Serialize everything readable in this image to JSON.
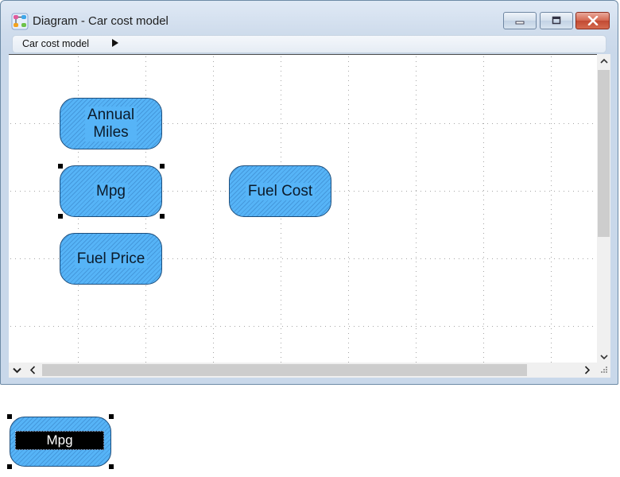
{
  "window": {
    "title": "Diagram - Car cost model",
    "controls": [
      "minimize",
      "maximize",
      "close"
    ]
  },
  "breadcrumb": {
    "items": [
      "Car cost model"
    ]
  },
  "nodes": [
    {
      "id": "annual-miles",
      "label": "Annual\nMiles",
      "selected": false
    },
    {
      "id": "mpg",
      "label": "Mpg",
      "selected": true
    },
    {
      "id": "fuel-price",
      "label": "Fuel Price",
      "selected": false
    },
    {
      "id": "fuel-cost",
      "label": "Fuel Cost",
      "selected": false
    }
  ],
  "preview": {
    "label": "Mpg",
    "editing": true
  },
  "colors": {
    "node_fill": "#56b4f7",
    "node_border": "#1d4f7e",
    "close_button": "#c9503a"
  },
  "icons": {
    "app": "diagram-icon",
    "breadcrumb": "triangle-right-icon",
    "scroll_up": "chevron-up-icon",
    "scroll_down": "chevron-down-icon",
    "scroll_left": "chevron-left-icon",
    "scroll_right": "chevron-right-icon"
  }
}
